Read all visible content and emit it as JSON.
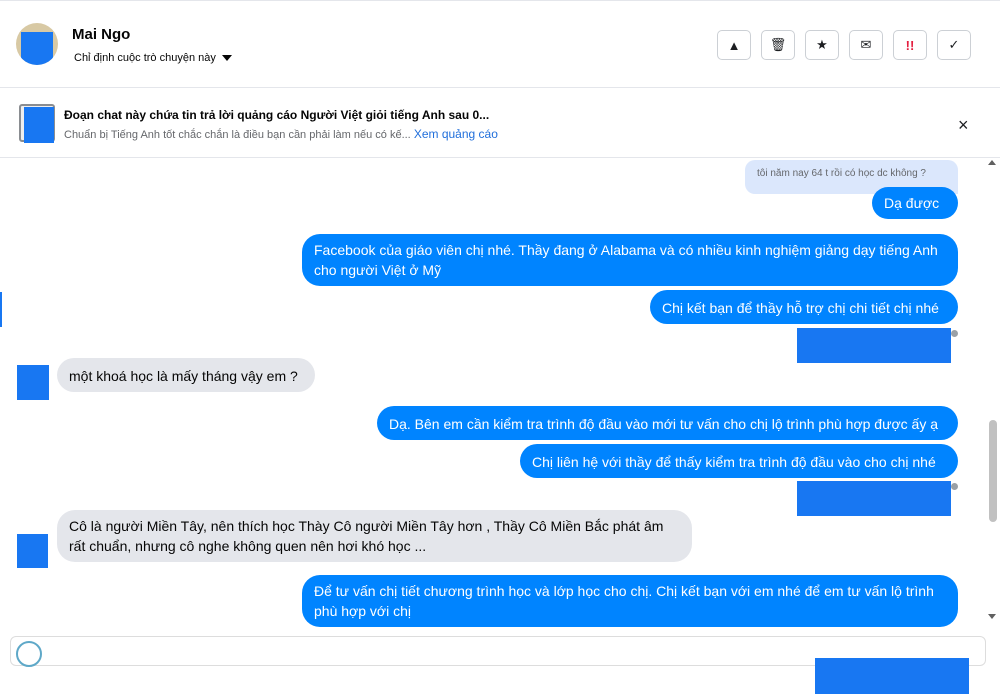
{
  "header": {
    "name": "Mai Ngo",
    "assign_label": "Chỉ định cuộc trò chuyện này",
    "toolbar": [
      {
        "icon": "warning-icon",
        "glyph": "▲"
      },
      {
        "icon": "trash-icon",
        "glyph": "🗑"
      },
      {
        "icon": "star-icon",
        "glyph": "★"
      },
      {
        "icon": "mail-icon",
        "glyph": "✉"
      },
      {
        "icon": "spam-icon",
        "glyph": "!!"
      },
      {
        "icon": "check-icon",
        "glyph": "✓"
      }
    ]
  },
  "ad": {
    "title": "Đoạn chat này chứa tin trả lời quảng cáo Người Việt giỏi tiếng Anh sau 0...",
    "subtitle": "Chuẩn bị Tiếng Anh tốt chắc chắn là điều bạn cần phải làm nếu có kế...",
    "link": "Xem quảng cáo",
    "close": "×"
  },
  "messages": {
    "quoted": "tôi năm nay 64 t rồi có học dc không ?",
    "m1": "Dạ được ạ",
    "m2": "Facebook của giáo viên chị nhé. Thầy đang ở Alabama và có nhiều kinh nghiệm giảng dạy tiếng Anh cho người Việt ở Mỹ",
    "m3": "Chị kết bạn để thầy hỗ trợ chị chi tiết chị nhé",
    "m4": "một khoá học là mấy tháng vậy em ?",
    "m5": "Dạ. Bên em cần kiểm tra trình độ đầu vào mới tư vấn cho chị lộ trình phù hợp được ấy ạ",
    "m6": "Chị liên hệ với thầy để thấy kiểm tra trình độ đầu vào cho chị nhé",
    "m7": "Cô là người Miền Tây, nên thích học Thày Cô người Miền Tây hơn , Thầy Cô Miền Bắc phát âm rất chuẩn, nhưng cô nghe không quen nên  hơi khó học ...",
    "m8": "Để tư vấn chị tiết chương trình học và lớp học cho chị. Chị kết bạn với em nhé để em tư vấn lộ trình phù hợp với chị"
  },
  "colors": {
    "outgoing": "#0084ff",
    "incoming": "#e4e6eb",
    "accent": "#1877f2"
  }
}
